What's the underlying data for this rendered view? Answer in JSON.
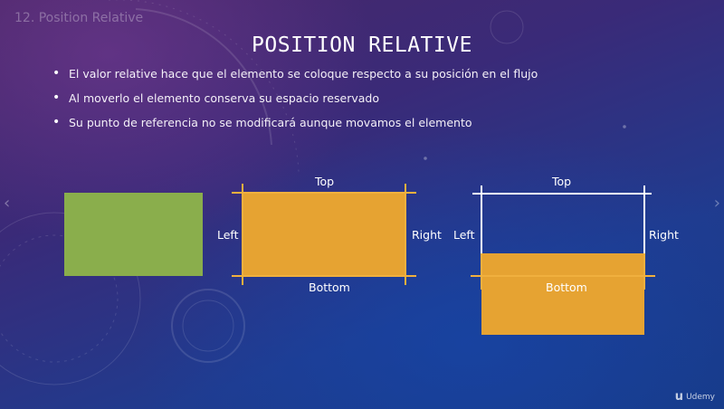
{
  "header": {
    "lecture_title": "12. Position Relative",
    "slide_title": "POSITION RELATIVE"
  },
  "bullets": [
    "El valor relative hace que el elemento se coloque respecto a su posición en el flujo",
    "Al moverlo el elemento conserva su espacio reservado",
    "Su punto de referencia no se modificará aunque movamos el elemento"
  ],
  "diagram_1": {
    "top": "Top",
    "left": "Left",
    "right": "Right",
    "bottom": "Bottom"
  },
  "diagram_2": {
    "top": "Top",
    "left": "Left",
    "right": "Right",
    "bottom": "Bottom"
  },
  "watermark": {
    "logo_glyph": "u",
    "text": "Udemy"
  },
  "colors": {
    "green_box": "#8aae4c",
    "orange_box": "#e6a332",
    "guide_line": "#f0b03e"
  }
}
